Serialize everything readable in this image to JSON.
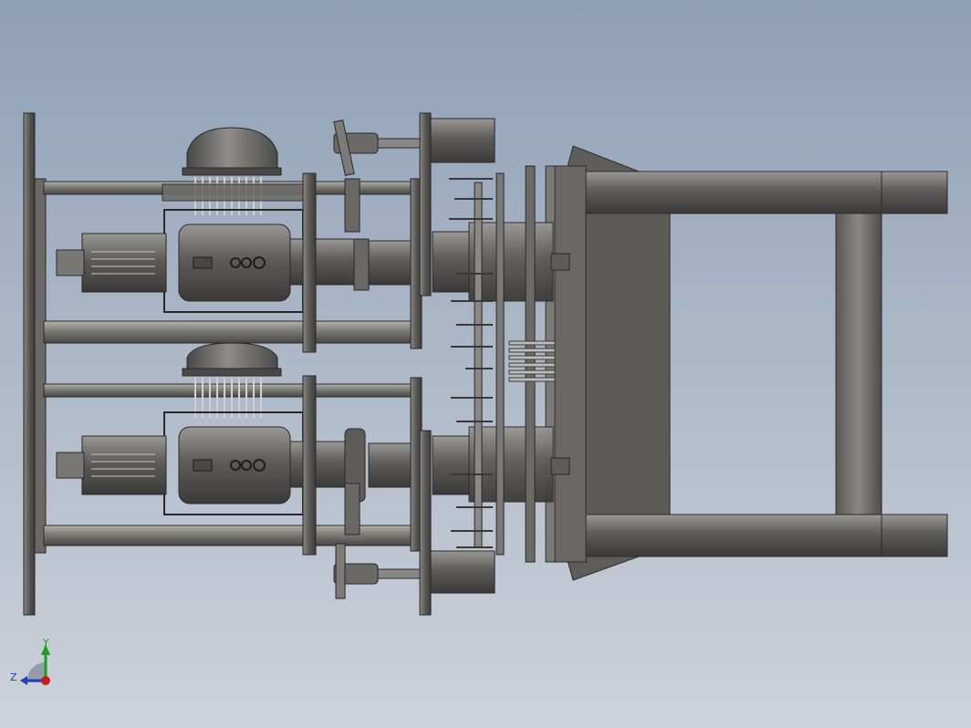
{
  "view": {
    "type": "cad-3d-viewport",
    "background_top": "#8ea0b6",
    "background_bottom": "#cdd2da",
    "part_color": "#6d6b68",
    "part_highlight": "#a8a6a2",
    "part_shadow": "#3f3d3b"
  },
  "triad": {
    "y_label": "Y",
    "z_label": "Z",
    "y_color": "#1aa01a",
    "z_color": "#2040c0",
    "origin_color": "#d01818"
  }
}
